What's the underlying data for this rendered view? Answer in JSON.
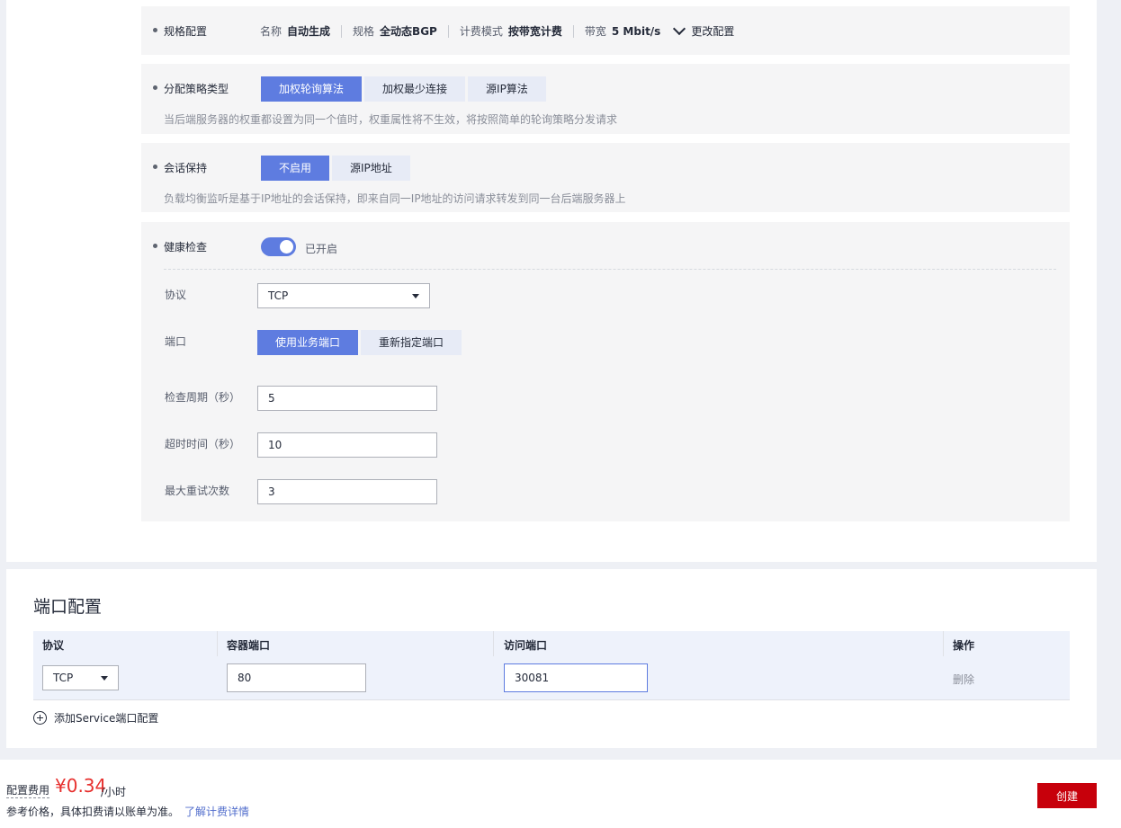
{
  "spec": {
    "label": "规格配置",
    "name_key": "名称",
    "name_val": "自动生成",
    "spec_key": "规格",
    "spec_val": "全动态BGP",
    "billing_key": "计费模式",
    "billing_val": "按带宽计费",
    "bandwidth_key": "带宽",
    "bandwidth_val": "5 Mbit/s",
    "change_label": "更改配置"
  },
  "strategy": {
    "label": "分配策略类型",
    "options": [
      "加权轮询算法",
      "加权最少连接",
      "源IP算法"
    ],
    "selected": "加权轮询算法",
    "hint": "当后端服务器的权重都设置为同一个值时，权重属性将不生效，将按照简单的轮询策略分发请求"
  },
  "session": {
    "label": "会话保持",
    "options": [
      "不启用",
      "源IP地址"
    ],
    "selected": "不启用",
    "hint": "负载均衡监听是基于IP地址的会话保持，即来自同一IP地址的访问请求转发到同一台后端服务器上"
  },
  "health": {
    "label": "健康检查",
    "toggle_text": "已开启",
    "enabled": true,
    "protocol_label": "协议",
    "protocol_value": "TCP",
    "port_label": "端口",
    "port_options": [
      "使用业务端口",
      "重新指定端口"
    ],
    "port_selected": "使用业务端口",
    "period_label": "检查周期（秒）",
    "period_value": "5",
    "timeout_label": "超时时间（秒）",
    "timeout_value": "10",
    "retries_label": "最大重试次数",
    "retries_value": "3"
  },
  "ports": {
    "title": "端口配置",
    "headers": [
      "协议",
      "容器端口",
      "访问端口",
      "操作"
    ],
    "rows": [
      {
        "protocol": "TCP",
        "container_port": "80",
        "access_port": "30081",
        "action": "删除"
      }
    ],
    "add_label": "添加Service端口配置"
  },
  "footer": {
    "fee_label": "配置费用",
    "price": "¥0.34",
    "unit": "/小时",
    "note": "参考价格，具体扣费请以账单为准。",
    "link": "了解计费详情",
    "create_label": "创建"
  },
  "colors": {
    "accent": "#5e7ce0",
    "price": "#e7302e",
    "create": "#c7000b",
    "link": "#526ecc"
  }
}
